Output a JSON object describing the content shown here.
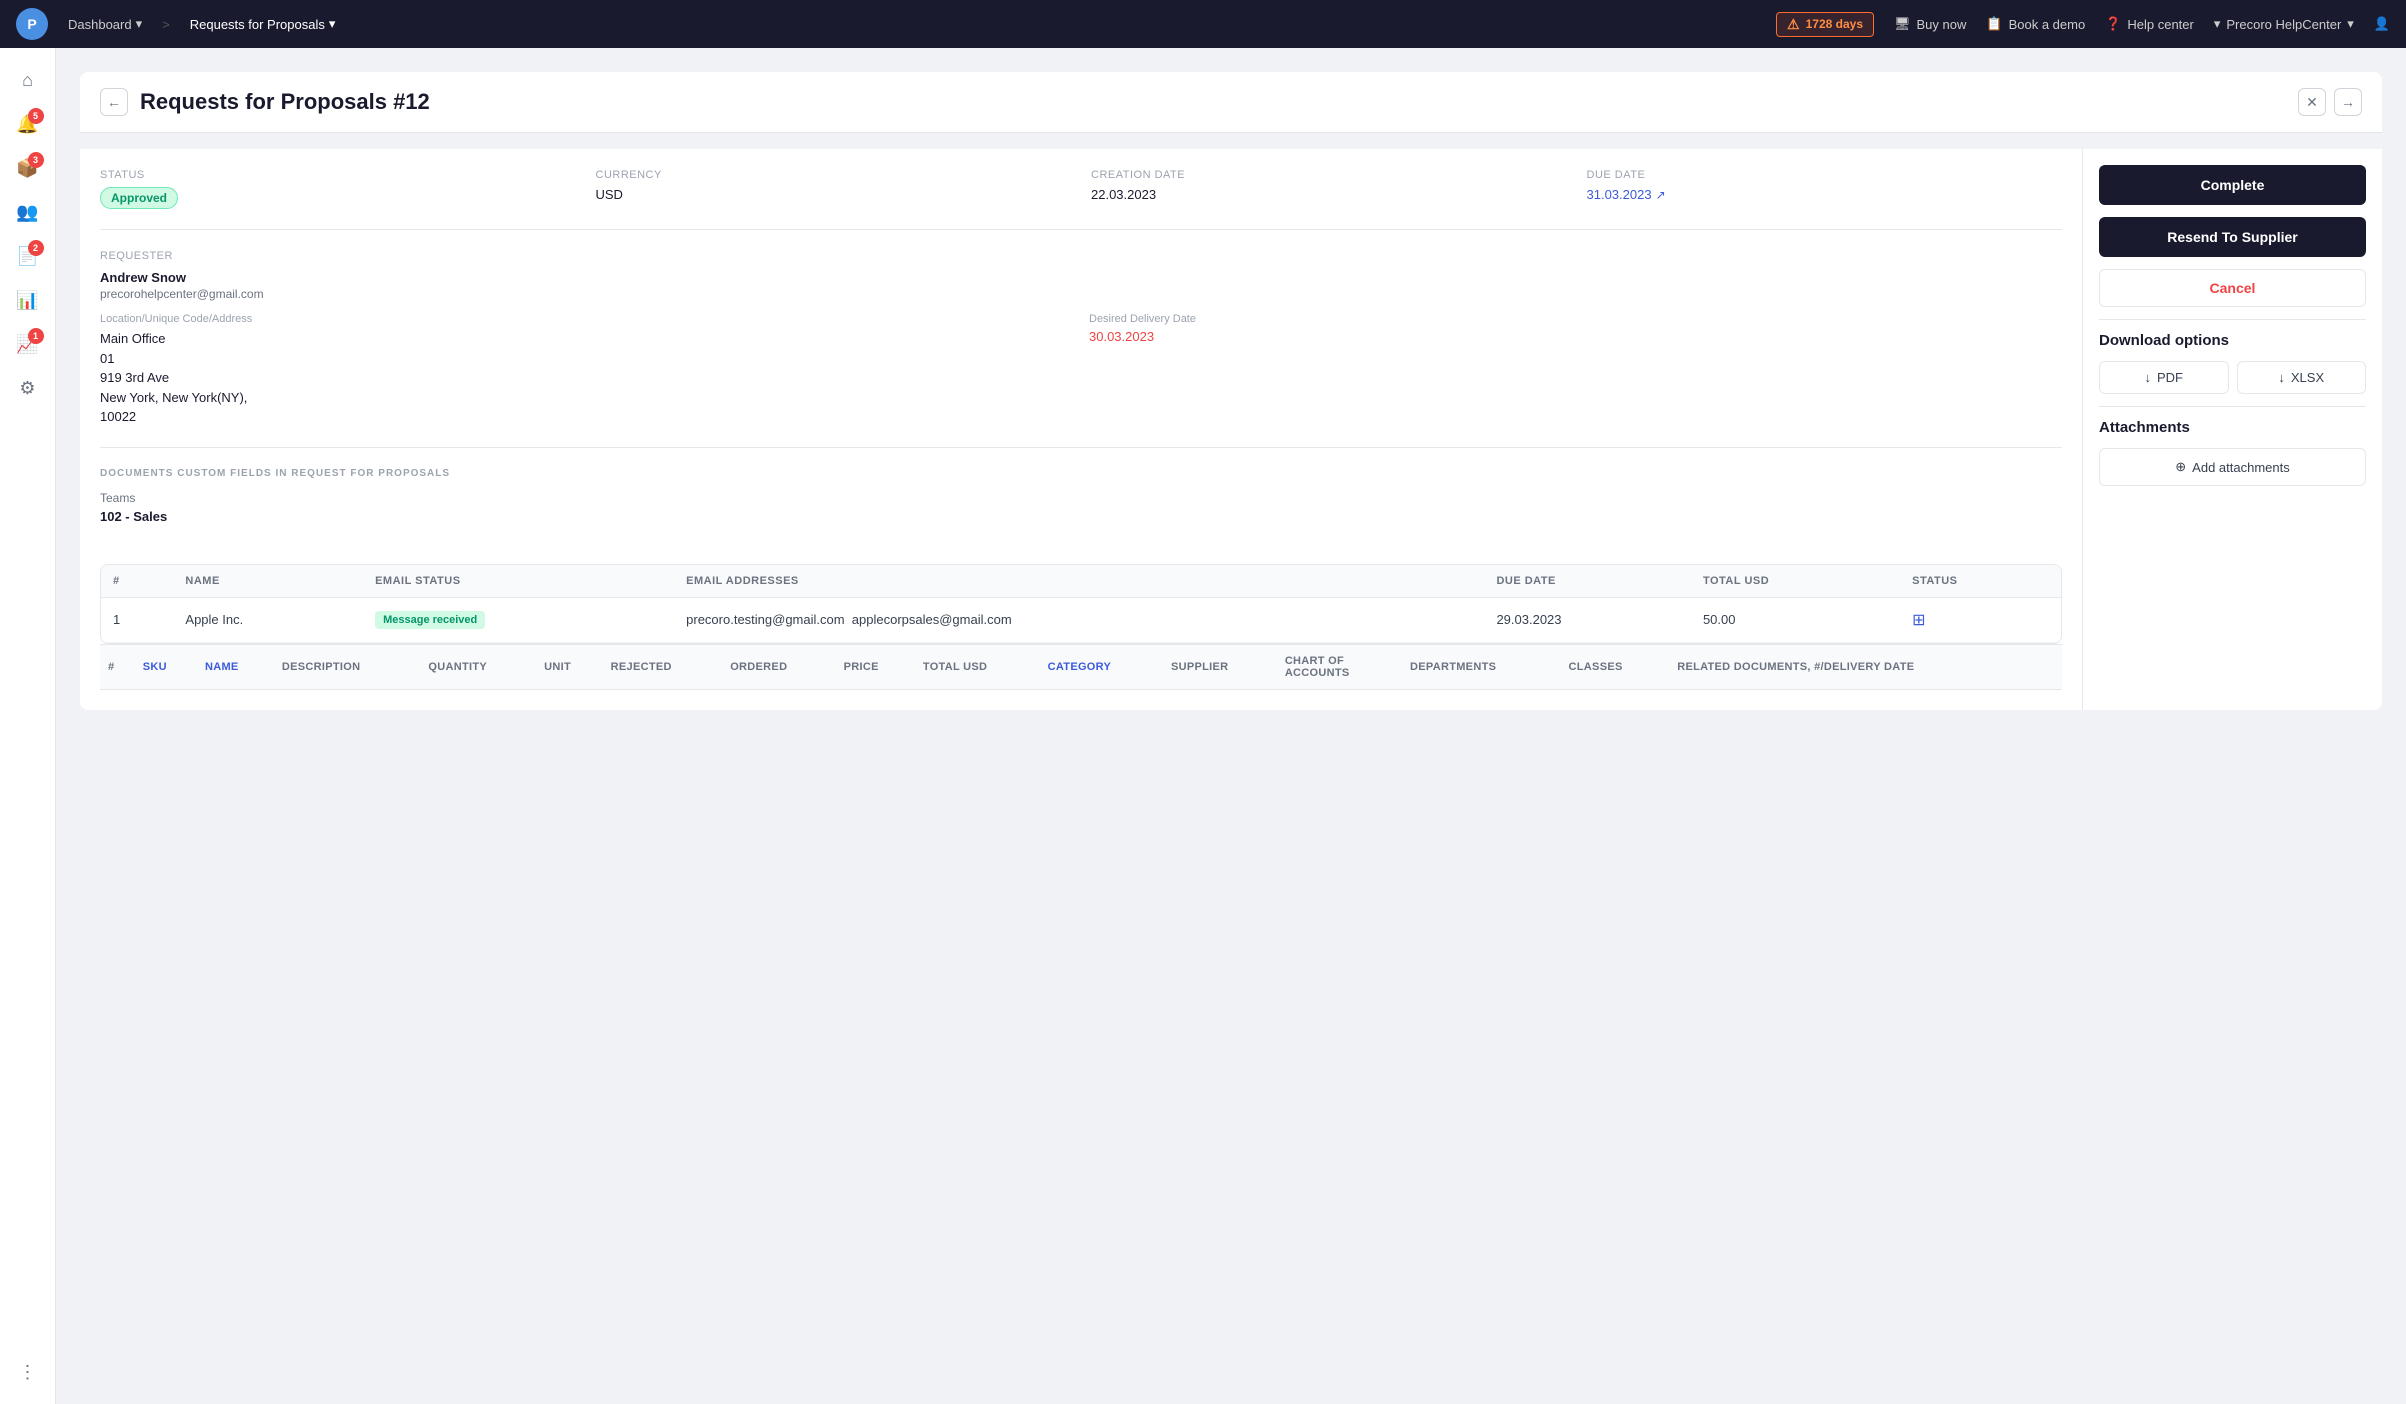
{
  "app": {
    "logo": "P",
    "nav": {
      "items": [
        {
          "label": "Dashboard",
          "active": false,
          "has_arrow": true
        },
        {
          "label": "Requests for Proposals",
          "active": true,
          "has_arrow": true
        }
      ]
    },
    "alert": {
      "icon": "⚠",
      "label": "1728 days"
    },
    "actions": [
      {
        "id": "buy-now",
        "icon": "🖥",
        "label": "Buy now"
      },
      {
        "id": "book-demo",
        "icon": "📋",
        "label": "Book a demo"
      },
      {
        "id": "help-center",
        "icon": "❓",
        "label": "Help center"
      },
      {
        "id": "precoro",
        "icon": "🏢",
        "label": "Precoro HelpCenter",
        "has_arrow": true
      },
      {
        "id": "user",
        "icon": "👤",
        "label": ""
      }
    ]
  },
  "sidebar": {
    "items": [
      {
        "id": "home",
        "icon": "⌂",
        "badge": null
      },
      {
        "id": "notifications",
        "icon": "🔔",
        "badge": "5"
      },
      {
        "id": "orders",
        "icon": "📦",
        "badge": "3"
      },
      {
        "id": "people",
        "icon": "👥",
        "badge": null
      },
      {
        "id": "documents",
        "icon": "📄",
        "badge": "2"
      },
      {
        "id": "reports",
        "icon": "📊",
        "badge": null
      },
      {
        "id": "analytics",
        "icon": "📈",
        "badge": "1"
      },
      {
        "id": "settings",
        "icon": "⚙",
        "badge": null
      },
      {
        "id": "more",
        "icon": "⋮⋮",
        "badge": null
      }
    ]
  },
  "page": {
    "title": "Requests for Proposals #12",
    "back_button": "←",
    "close_button": "✕",
    "expand_button": "→"
  },
  "document": {
    "status_label": "Status",
    "status_value": "Approved",
    "currency_label": "Currency",
    "currency_value": "USD",
    "creation_date_label": "Creation Date",
    "creation_date_value": "22.03.2023",
    "due_date_label": "Due Date",
    "due_date_value": "31.03.2023",
    "requester_label": "Requester",
    "requester_name": "Andrew Snow",
    "requester_email": "precorohelpcenter@gmail.com",
    "location_label": "Location/Unique Code/Address",
    "location_value": "Main Office\n01\n919 3rd Ave\nNew York, New York(NY),\n10022",
    "location_line1": "Main Office",
    "location_line2": "01",
    "location_line3": "919 3rd Ave",
    "location_line4": "New York, New York(NY),",
    "location_line5": "10022",
    "delivery_date_label": "Desired Delivery Date",
    "delivery_date_value": "30.03.2023",
    "custom_fields_heading": "DOCUMENTS CUSTOM FIELDS IN REQUEST FOR PROPOSALS",
    "custom_field_teams_label": "Teams",
    "custom_field_teams_value": "102 - Sales"
  },
  "right_panel": {
    "complete_btn": "Complete",
    "resend_btn": "Resend To Supplier",
    "cancel_btn": "Cancel",
    "download_heading": "Download options",
    "pdf_btn": "PDF",
    "xlsx_btn": "XLSX",
    "attachments_heading": "Attachments",
    "add_attachment_btn": "Add attachments"
  },
  "supplier_table": {
    "columns": [
      {
        "id": "num",
        "label": "#"
      },
      {
        "id": "name",
        "label": "Name"
      },
      {
        "id": "email_status",
        "label": "Email Status"
      },
      {
        "id": "email_addresses",
        "label": "Email Addresses"
      },
      {
        "id": "due_date",
        "label": "Due Date"
      },
      {
        "id": "total_usd",
        "label": "Total USD"
      },
      {
        "id": "status",
        "label": "Status"
      }
    ],
    "rows": [
      {
        "num": "1",
        "name": "Apple Inc.",
        "email_status": "Message received",
        "email_addresses": "precoro.testing@gmail.com  applecorpsales@gmail.com",
        "due_date": "29.03.2023",
        "total_usd": "50.00",
        "has_doc_icon": true
      }
    ]
  },
  "item_table": {
    "columns": [
      {
        "id": "num",
        "label": "#",
        "is_link": false
      },
      {
        "id": "sku",
        "label": "SKU",
        "is_link": true
      },
      {
        "id": "name",
        "label": "Name",
        "is_link": true
      },
      {
        "id": "description",
        "label": "Description",
        "is_link": false
      },
      {
        "id": "quantity",
        "label": "Quantity",
        "is_link": false
      },
      {
        "id": "unit",
        "label": "Unit",
        "is_link": false
      },
      {
        "id": "rejected",
        "label": "Rejected",
        "is_link": false
      },
      {
        "id": "ordered",
        "label": "Ordered",
        "is_link": false
      },
      {
        "id": "price",
        "label": "Price",
        "is_link": false
      },
      {
        "id": "total_usd",
        "label": "Total USD",
        "is_link": false
      },
      {
        "id": "category",
        "label": "Category",
        "is_link": true
      },
      {
        "id": "supplier",
        "label": "Supplier",
        "is_link": false
      },
      {
        "id": "chart_of_accounts",
        "label": "Chart of Accounts",
        "is_link": false
      },
      {
        "id": "departments",
        "label": "Departments",
        "is_link": false
      },
      {
        "id": "classes",
        "label": "Classes",
        "is_link": false
      },
      {
        "id": "related_docs",
        "label": "Related Documents, #/Delivery Date",
        "is_link": false
      }
    ]
  }
}
